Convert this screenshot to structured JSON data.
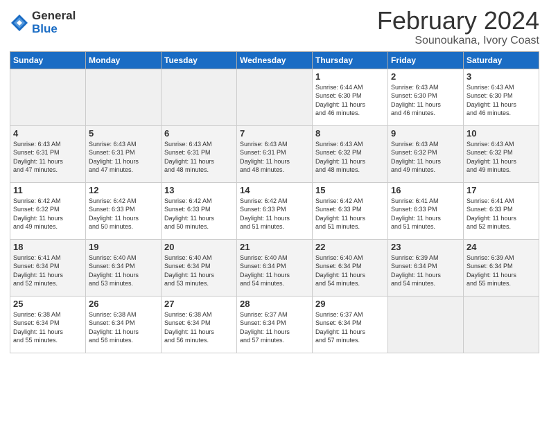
{
  "header": {
    "logo_general": "General",
    "logo_blue": "Blue",
    "month_year": "February 2024",
    "location": "Sounoukana, Ivory Coast"
  },
  "days_of_week": [
    "Sunday",
    "Monday",
    "Tuesday",
    "Wednesday",
    "Thursday",
    "Friday",
    "Saturday"
  ],
  "weeks": [
    [
      {
        "day": "",
        "info": ""
      },
      {
        "day": "",
        "info": ""
      },
      {
        "day": "",
        "info": ""
      },
      {
        "day": "",
        "info": ""
      },
      {
        "day": "1",
        "info": "Sunrise: 6:44 AM\nSunset: 6:30 PM\nDaylight: 11 hours\nand 46 minutes."
      },
      {
        "day": "2",
        "info": "Sunrise: 6:43 AM\nSunset: 6:30 PM\nDaylight: 11 hours\nand 46 minutes."
      },
      {
        "day": "3",
        "info": "Sunrise: 6:43 AM\nSunset: 6:30 PM\nDaylight: 11 hours\nand 46 minutes."
      }
    ],
    [
      {
        "day": "4",
        "info": "Sunrise: 6:43 AM\nSunset: 6:31 PM\nDaylight: 11 hours\nand 47 minutes."
      },
      {
        "day": "5",
        "info": "Sunrise: 6:43 AM\nSunset: 6:31 PM\nDaylight: 11 hours\nand 47 minutes."
      },
      {
        "day": "6",
        "info": "Sunrise: 6:43 AM\nSunset: 6:31 PM\nDaylight: 11 hours\nand 48 minutes."
      },
      {
        "day": "7",
        "info": "Sunrise: 6:43 AM\nSunset: 6:31 PM\nDaylight: 11 hours\nand 48 minutes."
      },
      {
        "day": "8",
        "info": "Sunrise: 6:43 AM\nSunset: 6:32 PM\nDaylight: 11 hours\nand 48 minutes."
      },
      {
        "day": "9",
        "info": "Sunrise: 6:43 AM\nSunset: 6:32 PM\nDaylight: 11 hours\nand 49 minutes."
      },
      {
        "day": "10",
        "info": "Sunrise: 6:43 AM\nSunset: 6:32 PM\nDaylight: 11 hours\nand 49 minutes."
      }
    ],
    [
      {
        "day": "11",
        "info": "Sunrise: 6:42 AM\nSunset: 6:32 PM\nDaylight: 11 hours\nand 49 minutes."
      },
      {
        "day": "12",
        "info": "Sunrise: 6:42 AM\nSunset: 6:33 PM\nDaylight: 11 hours\nand 50 minutes."
      },
      {
        "day": "13",
        "info": "Sunrise: 6:42 AM\nSunset: 6:33 PM\nDaylight: 11 hours\nand 50 minutes."
      },
      {
        "day": "14",
        "info": "Sunrise: 6:42 AM\nSunset: 6:33 PM\nDaylight: 11 hours\nand 51 minutes."
      },
      {
        "day": "15",
        "info": "Sunrise: 6:42 AM\nSunset: 6:33 PM\nDaylight: 11 hours\nand 51 minutes."
      },
      {
        "day": "16",
        "info": "Sunrise: 6:41 AM\nSunset: 6:33 PM\nDaylight: 11 hours\nand 51 minutes."
      },
      {
        "day": "17",
        "info": "Sunrise: 6:41 AM\nSunset: 6:33 PM\nDaylight: 11 hours\nand 52 minutes."
      }
    ],
    [
      {
        "day": "18",
        "info": "Sunrise: 6:41 AM\nSunset: 6:34 PM\nDaylight: 11 hours\nand 52 minutes."
      },
      {
        "day": "19",
        "info": "Sunrise: 6:40 AM\nSunset: 6:34 PM\nDaylight: 11 hours\nand 53 minutes."
      },
      {
        "day": "20",
        "info": "Sunrise: 6:40 AM\nSunset: 6:34 PM\nDaylight: 11 hours\nand 53 minutes."
      },
      {
        "day": "21",
        "info": "Sunrise: 6:40 AM\nSunset: 6:34 PM\nDaylight: 11 hours\nand 54 minutes."
      },
      {
        "day": "22",
        "info": "Sunrise: 6:40 AM\nSunset: 6:34 PM\nDaylight: 11 hours\nand 54 minutes."
      },
      {
        "day": "23",
        "info": "Sunrise: 6:39 AM\nSunset: 6:34 PM\nDaylight: 11 hours\nand 54 minutes."
      },
      {
        "day": "24",
        "info": "Sunrise: 6:39 AM\nSunset: 6:34 PM\nDaylight: 11 hours\nand 55 minutes."
      }
    ],
    [
      {
        "day": "25",
        "info": "Sunrise: 6:38 AM\nSunset: 6:34 PM\nDaylight: 11 hours\nand 55 minutes."
      },
      {
        "day": "26",
        "info": "Sunrise: 6:38 AM\nSunset: 6:34 PM\nDaylight: 11 hours\nand 56 minutes."
      },
      {
        "day": "27",
        "info": "Sunrise: 6:38 AM\nSunset: 6:34 PM\nDaylight: 11 hours\nand 56 minutes."
      },
      {
        "day": "28",
        "info": "Sunrise: 6:37 AM\nSunset: 6:34 PM\nDaylight: 11 hours\nand 57 minutes."
      },
      {
        "day": "29",
        "info": "Sunrise: 6:37 AM\nSunset: 6:34 PM\nDaylight: 11 hours\nand 57 minutes."
      },
      {
        "day": "",
        "info": ""
      },
      {
        "day": "",
        "info": ""
      }
    ]
  ]
}
